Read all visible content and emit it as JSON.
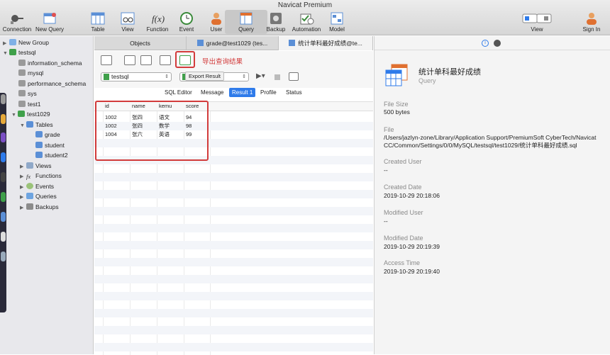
{
  "window": {
    "title": "Navicat Premium"
  },
  "toolbar": {
    "connection": "Connection",
    "new_query": "New Query",
    "table": "Table",
    "view": "View",
    "function": "Function",
    "event": "Event",
    "user": "User",
    "query": "Query",
    "backup": "Backup",
    "automation": "Automation",
    "model": "Model",
    "view_toggle": "View",
    "sign_in": "Sign In"
  },
  "sidebar": {
    "new_group": "New Group",
    "connection": "testsql",
    "databases": [
      "information_schema",
      "mysql",
      "performance_schema",
      "sys",
      "test1"
    ],
    "open_db": "test1029",
    "tables_label": "Tables",
    "tables": [
      "grade",
      "student",
      "student2"
    ],
    "views": "Views",
    "functions": "Functions",
    "events": "Events",
    "queries": "Queries",
    "backups": "Backups"
  },
  "tabs": {
    "objects": "Objects",
    "tab2": "grade@test1029 (tes...",
    "tab3": "统计单科最好成绩@te..."
  },
  "editor": {
    "annotation": "导出查询结果",
    "connection_select": "testsql",
    "tooltip": "Export Result"
  },
  "subtabs": {
    "sql_editor": "SQL Editor",
    "message": "Message",
    "result1": "Result 1",
    "profile": "Profile",
    "status": "Status"
  },
  "result": {
    "columns": [
      "id",
      "name",
      "kemu",
      "score"
    ],
    "rows": [
      [
        "1002",
        "张四",
        "语文",
        "94"
      ],
      [
        "1002",
        "张四",
        "数学",
        "98"
      ],
      [
        "1004",
        "张六",
        "英语",
        "99"
      ]
    ]
  },
  "info": {
    "name": "统计单科最好成绩",
    "type": "Query",
    "file_size_label": "File Size",
    "file_size": "500 bytes",
    "file_label": "File",
    "file_path": "/Users/jazlyn-zone/Library/Application Support/PremiumSoft CyberTech/Navicat CC/Common/Settings/0/0/MySQL/testsql/test1029/统计单科最好成绩.sql",
    "created_user_label": "Created User",
    "created_user": "--",
    "created_date_label": "Created Date",
    "created_date": "2019-10-29 20:18:06",
    "modified_user_label": "Modified User",
    "modified_user": "--",
    "modified_date_label": "Modified Date",
    "modified_date": "2019-10-29 20:19:39",
    "access_time_label": "Access Time",
    "access_time": "2019-10-29 20:19:40"
  },
  "colors": {
    "accent": "#2f7bea",
    "annotation": "#d23b3b",
    "db_green": "#3fa04a"
  }
}
